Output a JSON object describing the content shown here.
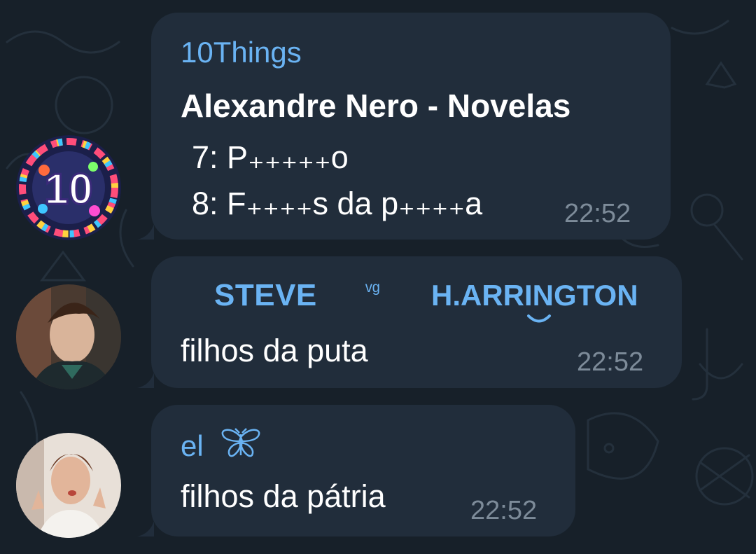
{
  "colors": {
    "background": "#172029",
    "bubble": "#212d3b",
    "sender_name": "#6ab3f3",
    "message_text": "#ffffff",
    "timestamp": "#7d8b99"
  },
  "messages": [
    {
      "sender": "10Things",
      "avatar_icon": "10things-avatar",
      "title": "Alexandre Nero - Novelas",
      "lines": [
        "7: P₊₊₊₊₊o",
        "8: F₊₊₊₊s da p₊₊₊₊a"
      ],
      "time": "22:52"
    },
    {
      "sender_part1": "STEVE",
      "sender_sep": "ᵛᵍ",
      "sender_part2": "H.ARRINGTON",
      "avatar_icon": "steve-avatar",
      "text": "filhos da puta",
      "time": "22:52"
    },
    {
      "sender": "el",
      "sender_emoji": "butterfly-icon",
      "avatar_icon": "el-avatar",
      "text": "filhos da pátria",
      "time": "22:52"
    }
  ]
}
